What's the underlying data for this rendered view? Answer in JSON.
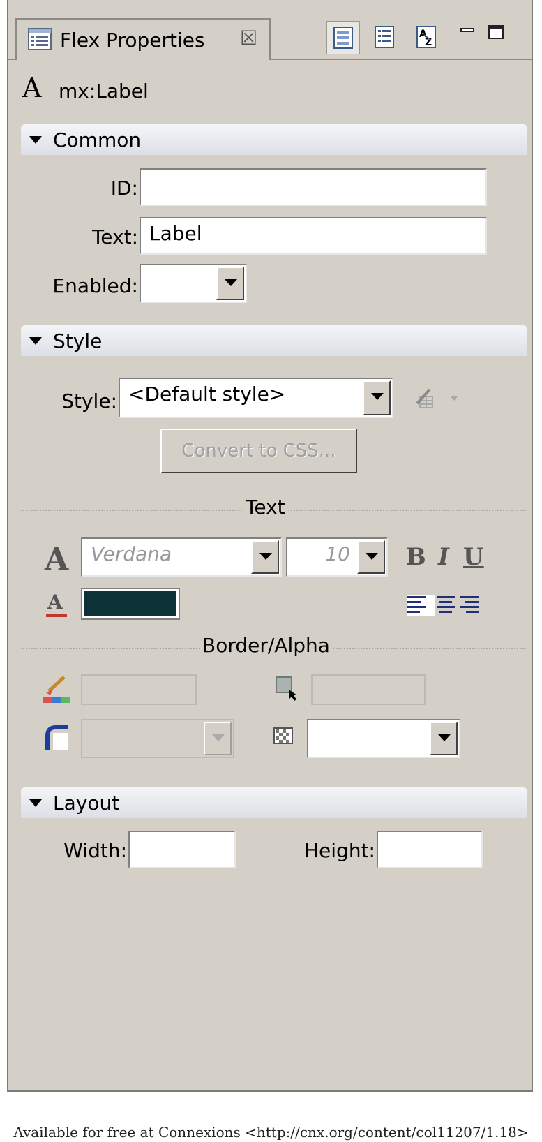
{
  "tab": {
    "title": "Flex Properties",
    "close_glyph": "☒",
    "view_icons": [
      "standard-view-icon",
      "category-view-icon",
      "alphabetical-view-icon",
      "minimize-icon",
      "maximize-icon"
    ]
  },
  "component": {
    "icon": "A",
    "name": "mx:Label"
  },
  "common": {
    "title": "Common",
    "id_label": "ID:",
    "id_value": "",
    "text_label": "Text:",
    "text_value": "Label",
    "enabled_label": "Enabled:",
    "enabled_value": ""
  },
  "style": {
    "title": "Style",
    "style_label": "Style:",
    "style_value": "<Default style>",
    "convert_button": "Convert to CSS...",
    "text_section": "Text",
    "font_glyph": "A",
    "font_family": "Verdana",
    "font_size": "10",
    "bold": "B",
    "italic": "I",
    "underline": "U",
    "text_color": "#0d3338",
    "border_alpha_section": "Border/Alpha"
  },
  "layout": {
    "title": "Layout",
    "width_label": "Width:",
    "width_value": "",
    "height_label": "Height:",
    "height_value": ""
  },
  "footer": {
    "credit": "Available for free at Connexions <http://cnx.org/content/col11207/1.18>"
  }
}
